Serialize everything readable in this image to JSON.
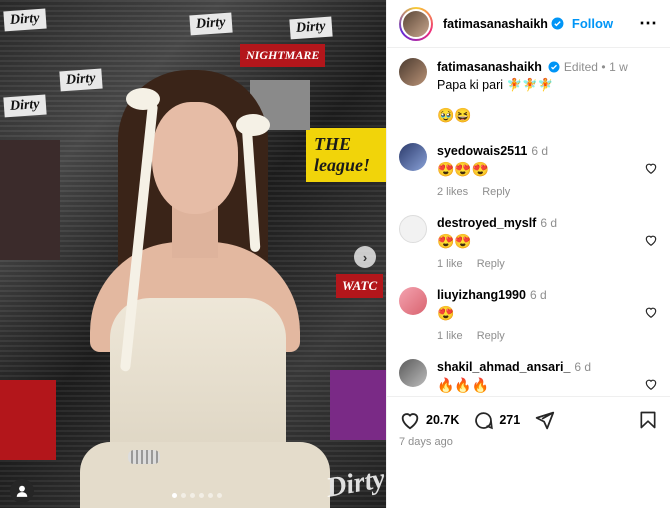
{
  "media": {
    "posters": {
      "dirty": "Dirty",
      "nightmare": "NIGHTMARE",
      "league": "THE league!",
      "watch": "WATC"
    },
    "watermark": "Dirty"
  },
  "post": {
    "username": "fatimasanashaikh",
    "follow_label": "Follow",
    "more_icon": "⋯",
    "caption": {
      "username": "fatimasanashaikh",
      "edited": "Edited",
      "separator": "•",
      "time": "1 w",
      "text": "Papa ki pari 🧚🧚🧚",
      "emojis": "🥹😆"
    },
    "comments": [
      {
        "username": "syedowais2511",
        "time": "6 d",
        "text": "😍😍😍",
        "likes": "2 likes",
        "reply": "Reply"
      },
      {
        "username": "destroyed_myslf",
        "time": "6 d",
        "text": "😍😍",
        "likes": "1 like",
        "reply": "Reply"
      },
      {
        "username": "liuyizhang1990",
        "time": "6 d",
        "text": "😍",
        "likes": "1 like",
        "reply": "Reply"
      },
      {
        "username": "shakil_ahmad_ansari_",
        "time": "6 d",
        "text": "🔥🔥🔥"
      }
    ],
    "stats": {
      "likes": "20.7K",
      "comments": "271"
    },
    "posted": "7 days ago"
  },
  "colors": {
    "accent": "#0095f6",
    "verified": "#0095f6",
    "muted": "#8e8e8e"
  }
}
